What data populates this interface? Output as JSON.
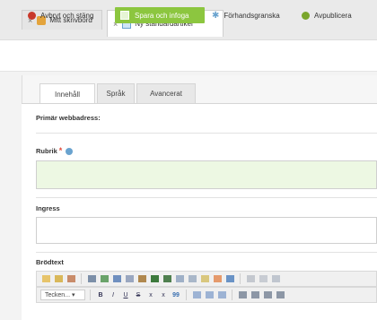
{
  "tabs": [
    {
      "label": "Mitt skrivbord",
      "close": "×"
    },
    {
      "label": "Ny standardartikel",
      "close": "×",
      "dirty": "*"
    }
  ],
  "toolbar": {
    "cancel": "Avbryt och stäng",
    "save": "Spara och infoga",
    "preview": "Förhandsgranska",
    "unpublish": "Avpublicera"
  },
  "content_tabs": [
    "Innehåll",
    "Språk",
    "Avancerat"
  ],
  "fields": {
    "primary_url": "Primär webbadress:",
    "title": "Rubrik",
    "title_required": "*",
    "ingress": "Ingress",
    "body": "Brödtext"
  },
  "editor": {
    "format_select": "Tecken...",
    "bold": "B",
    "italic": "I",
    "underline": "U",
    "strike": "S",
    "subscript": "x",
    "superscript": "x",
    "quote": "99"
  },
  "colors": {
    "save_green": "#8cc63f",
    "required_red": "#e14b3d",
    "field_green": "#edf8e3"
  }
}
